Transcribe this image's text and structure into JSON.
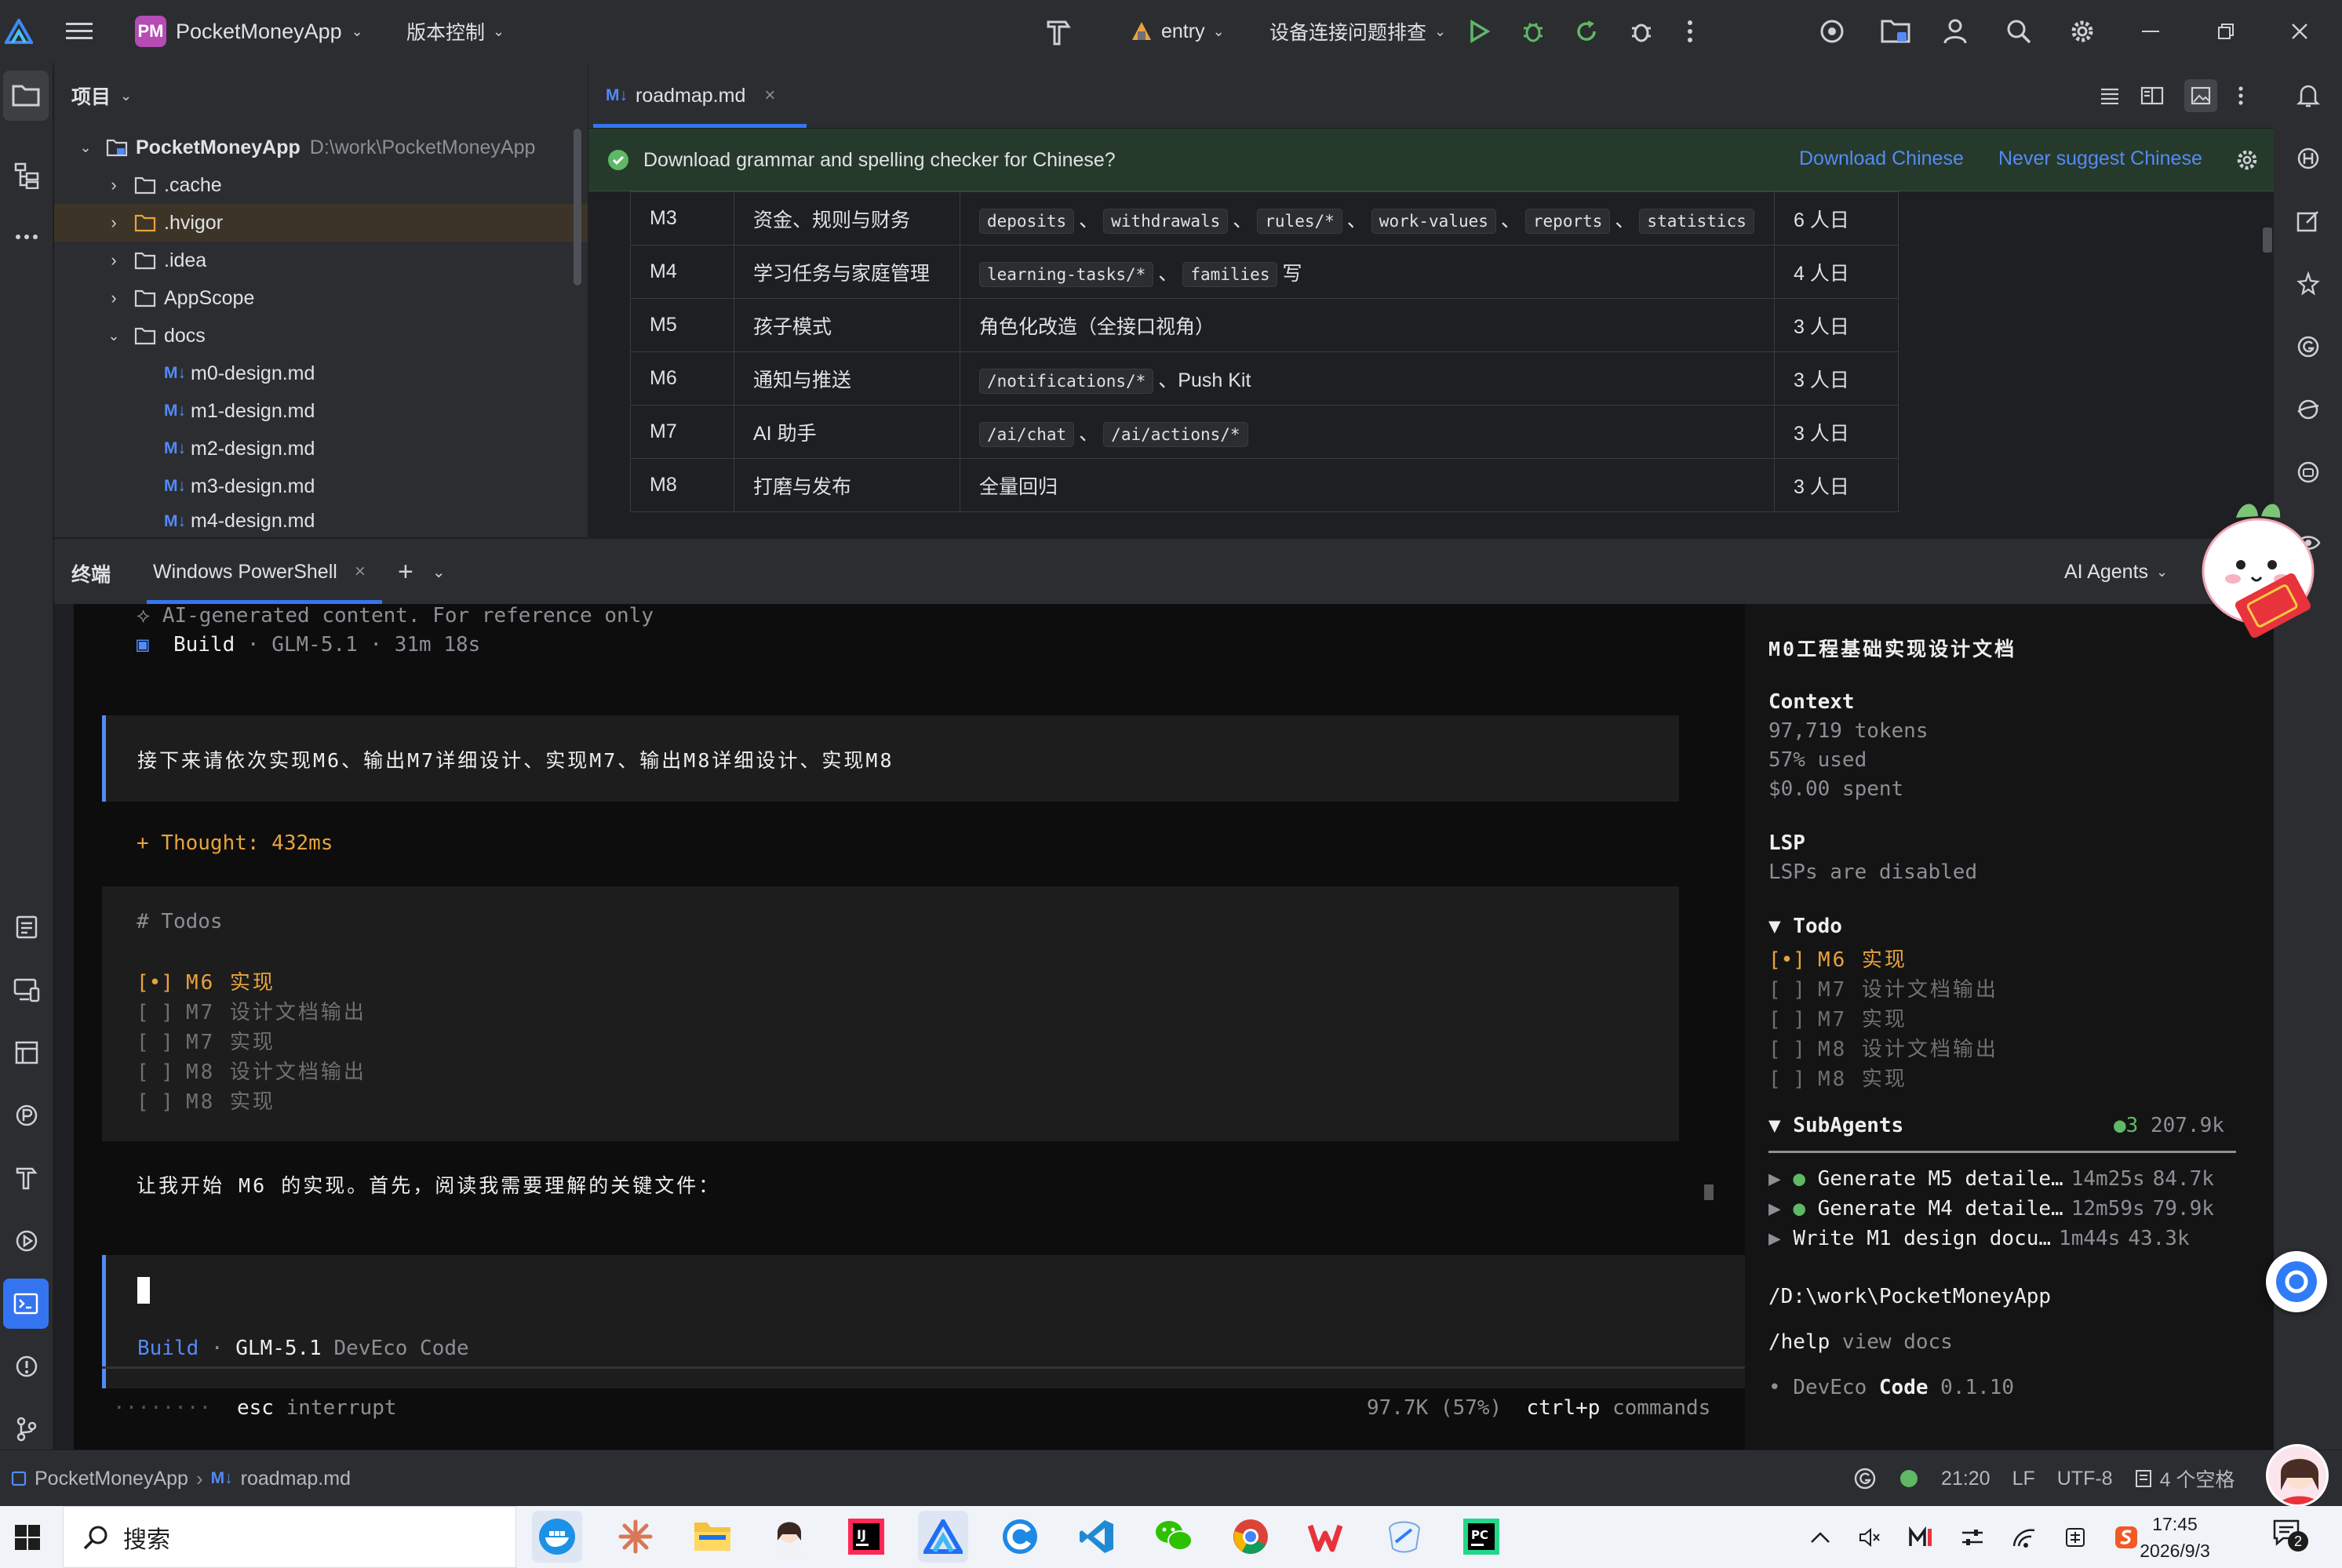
{
  "titlebar": {
    "project_badge": "PM",
    "project_name": "PocketMoneyApp",
    "vcs_label": "版本控制",
    "run_config": "entry",
    "device_label": "设备连接问题排查"
  },
  "project_panel": {
    "title": "项目",
    "root_name": "PocketMoneyApp",
    "root_path": "D:\\work\\PocketMoneyApp",
    "items": [
      {
        "label": ".cache",
        "kind": "folder"
      },
      {
        "label": ".hvigor",
        "kind": "folder"
      },
      {
        "label": ".idea",
        "kind": "folder"
      },
      {
        "label": "AppScope",
        "kind": "folder"
      },
      {
        "label": "docs",
        "kind": "folder-open"
      },
      {
        "label": "m0-design.md",
        "kind": "md"
      },
      {
        "label": "m1-design.md",
        "kind": "md"
      },
      {
        "label": "m2-design.md",
        "kind": "md"
      },
      {
        "label": "m3-design.md",
        "kind": "md"
      },
      {
        "label": "m4-design.md",
        "kind": "md"
      }
    ],
    "md_badge": "M↓"
  },
  "editor": {
    "tab_label": "roadmap.md",
    "banner": {
      "message": "Download grammar and spelling checker for Chinese?",
      "action1": "Download Chinese",
      "action2": "Never suggest Chinese"
    },
    "table": [
      {
        "id": "M3",
        "name": "资金、规则与财务",
        "codes": [
          "deposits",
          "withdrawals",
          "rules/*",
          "work-values",
          "reports",
          "statistics"
        ],
        "tail": "",
        "text": "",
        "effort": "6 人日"
      },
      {
        "id": "M4",
        "name": "学习任务与家庭管理",
        "codes": [
          "learning-tasks/*",
          "families"
        ],
        "tail": "写",
        "text": "",
        "effort": "4 人日"
      },
      {
        "id": "M5",
        "name": "孩子模式",
        "codes": [],
        "tail": "",
        "text": "角色化改造（全接口视角）",
        "effort": "3 人日"
      },
      {
        "id": "M6",
        "name": "通知与推送",
        "codes": [
          "/notifications/*"
        ],
        "tail": "、Push Kit",
        "text": "",
        "effort": "3 人日"
      },
      {
        "id": "M7",
        "name": "AI 助手",
        "codes": [
          "/ai/chat",
          "/ai/actions/*"
        ],
        "tail": "",
        "text": "",
        "effort": "3 人日"
      },
      {
        "id": "M8",
        "name": "打磨与发布",
        "codes": [],
        "tail": "",
        "text": "全量回归",
        "effort": "3 人日"
      }
    ],
    "sep": "、"
  },
  "terminal": {
    "title": "终端",
    "tab_label": "Windows PowerShell",
    "ai_agents_label": "AI Agents",
    "lines": {
      "ai_note": "⟡ AI-generated content. For reference only",
      "build_label": "Build",
      "build_meta": " · GLM-5.1 · 31m 18s",
      "user_msg": "接下来请依次实现M6、输出M7详细设计、实现M7、输出M8详细设计、实现M8",
      "thought": "+ Thought: 432ms",
      "todos_header": "# Todos",
      "todos": [
        {
          "mark": "[•]",
          "text": "M6 实现",
          "active": true
        },
        {
          "mark": "[ ]",
          "text": "M7 设计文档输出",
          "active": false
        },
        {
          "mark": "[ ]",
          "text": "M7 实现",
          "active": false
        },
        {
          "mark": "[ ]",
          "text": "M8 设计文档输出",
          "active": false
        },
        {
          "mark": "[ ]",
          "text": "M8 实现",
          "active": false
        }
      ],
      "assistant_msg": "让我开始 M6 的实现。首先，阅读我需要理解的关键文件：",
      "input_build": "Build",
      "input_dot": " · ",
      "input_model": "GLM-5.1",
      "input_tool": " DevEco Code",
      "footer_dots": "········",
      "footer_esc": "esc",
      "footer_interrupt": " interrupt",
      "footer_usage": "97.7K (57%)",
      "footer_ctrl": "ctrl+p",
      "footer_commands": " commands"
    }
  },
  "sidepanel": {
    "title": "M0工程基础实现设计文档",
    "context_label": "Context",
    "tokens": "97,719 tokens",
    "used": "57% used",
    "spent": "$0.00 spent",
    "lsp_label": "LSP",
    "lsp_status": "LSPs are disabled",
    "todo_label": "▼ Todo",
    "todos": [
      {
        "mark": "[•]",
        "text": "M6 实现",
        "active": true
      },
      {
        "mark": "[ ]",
        "text": "M7 设计文档输出",
        "active": false
      },
      {
        "mark": "[ ]",
        "text": "M7 实现",
        "active": false
      },
      {
        "mark": "[ ]",
        "text": "M8 设计文档输出",
        "active": false
      },
      {
        "mark": "[ ]",
        "text": "M8 实现",
        "active": false
      }
    ],
    "subagents_label": "▼ SubAgents",
    "subagents_count": "●3",
    "subagents_total": "207.9k",
    "subagents": [
      {
        "name": "Generate M5 detaile…",
        "time": "14m25s",
        "tokens": "84.7k",
        "bullet": "●"
      },
      {
        "name": "Generate M4 detaile…",
        "time": "12m59s",
        "tokens": "79.9k",
        "bullet": "●"
      },
      {
        "name": "Write M1 design docu…",
        "time": "1m44s",
        "tokens": "43.3k",
        "bullet": ""
      }
    ],
    "path": "/D:\\work\\PocketMoneyApp",
    "help_cmd": "/help",
    "help_text": " view docs",
    "version_prefix": "• DevEco ",
    "version_bold": "Code",
    "version_num": " 0.1.10"
  },
  "statusbar": {
    "project": "PocketMoneyApp",
    "file": "roadmap.md",
    "position": "21:20",
    "line_sep": "LF",
    "encoding": "UTF-8",
    "indent": "4 个空格"
  },
  "taskbar": {
    "search_placeholder": "搜索",
    "time": "17:45",
    "date": "2026/9/3",
    "notif_count": "2"
  },
  "colors": {
    "accent_orange": "#e8a33d",
    "link_blue": "#548af7",
    "green": "#5fb865",
    "terminal_bg": "#0d0d0d"
  }
}
